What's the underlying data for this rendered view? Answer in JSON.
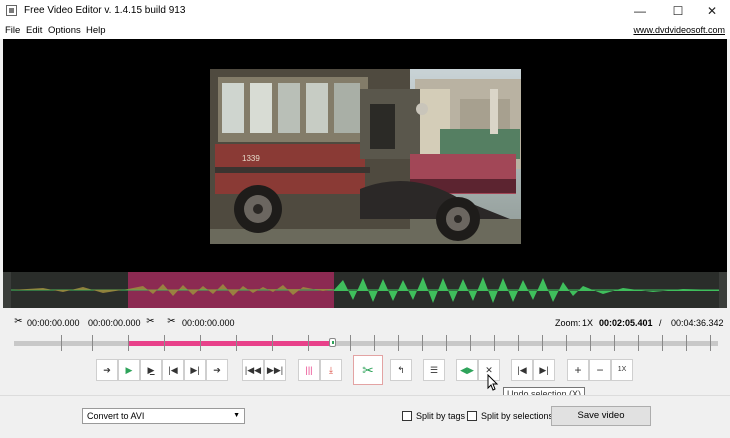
{
  "window": {
    "title": "Free Video Editor v. 1.4.15 build 913",
    "minimize": "—",
    "maximize": "☐",
    "close": "✕"
  },
  "menu": {
    "items": [
      "File",
      "Edit",
      "Options",
      "Help"
    ],
    "site_link": "www.dvdvideosoft.com"
  },
  "info": {
    "sel_start": "00:00:00.000",
    "sel_end": "00:00:00.000",
    "cut_time": "00:00:00.000",
    "zoom_label": "Zoom:",
    "zoom_value": "1X",
    "current_time": "00:02:05.401",
    "separator": "/",
    "total_time": "00:04:36.342"
  },
  "timeline": {
    "selection_start_fraction": 0.162,
    "selection_end_fraction": 0.452,
    "playhead_fraction": 0.452
  },
  "toolbar": {
    "icons": [
      "arrow-left-icon",
      "play-icon",
      "play-to-end-icon",
      "previous-frame-icon",
      "next-frame-icon",
      "arrow-right-icon",
      "go-to-start-icon",
      "go-to-end-icon",
      "split-markers-icon",
      "download-marker-icon",
      "cut-scissors-icon",
      "rotate-icon",
      "settings-icon",
      "color-selection-icon",
      "undo-selection-icon",
      "jump-start-icon",
      "jump-end-icon",
      "zoom-in-icon",
      "zoom-out-icon"
    ],
    "zoom_reset": "1X",
    "tooltip": "Undo selection (X)"
  },
  "bottom": {
    "format_selected": "Convert to AVI",
    "split_by_tags": "Split by tags",
    "split_by_selections": "Split by selections",
    "save_label": "Save video"
  },
  "colors": {
    "selection": "#e8418a",
    "waveform": "#3fbf5c",
    "accent_green": "#2ea35a"
  }
}
